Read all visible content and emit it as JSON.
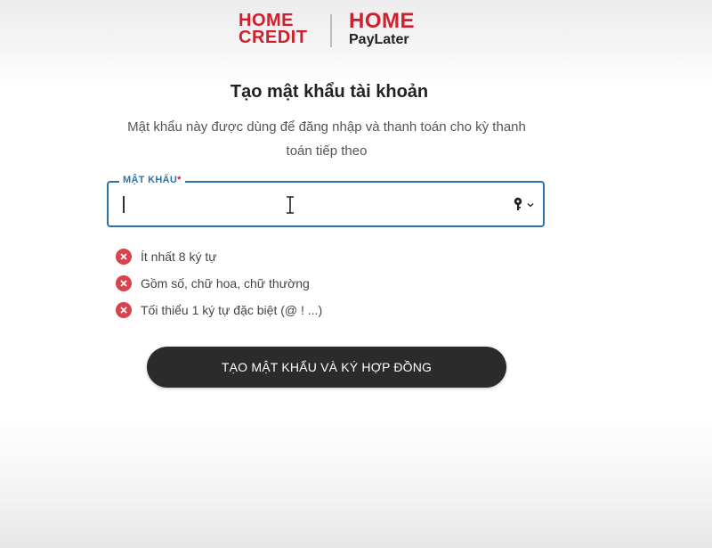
{
  "logo": {
    "home_credit_line1": "HOME",
    "home_credit_line2": "CREDIT",
    "paylater_line1": "HOME",
    "paylater_line2": "PayLater",
    "brand_color": "#d0202e"
  },
  "title": "Tạo mật khẩu tài khoản",
  "subtitle": "Mật khẩu này được dùng để đăng nhập và thanh toán cho kỳ thanh toán tiếp theo",
  "password_field": {
    "label": "MẬT KHẨU",
    "required_mark": "*",
    "value": "",
    "accent_color": "#2d73a8",
    "key_icon": "key-icon"
  },
  "rules": [
    {
      "text": "Ít nhất 8 ký tự",
      "status": "unmet"
    },
    {
      "text": "Gồm số, chữ hoa, chữ thường",
      "status": "unmet"
    },
    {
      "text": "Tối thiểu 1 ký tự đặc biệt (@ ! ...)",
      "status": "unmet"
    }
  ],
  "rule_fail_color": "#d9434b",
  "submit_button": {
    "label": "TẠO MẬT KHẨU VÀ KÝ HỢP ĐỒNG",
    "color": "#2b2b2b"
  }
}
